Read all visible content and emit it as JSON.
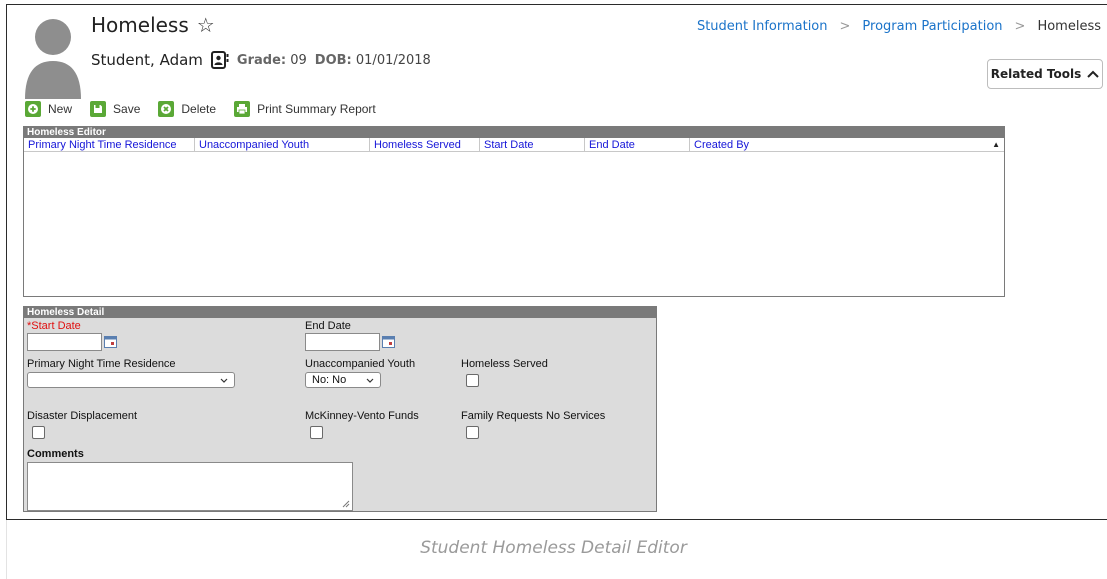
{
  "header": {
    "title": "Homeless",
    "student_name": "Student, Adam",
    "grade_label": "Grade:",
    "grade_value": "09",
    "dob_label": "DOB:",
    "dob_value": "01/01/2018"
  },
  "breadcrumb": {
    "items": [
      "Student Information",
      "Program Participation",
      "Homeless"
    ],
    "separator": ">"
  },
  "related_tools": {
    "label": "Related Tools"
  },
  "toolbar": {
    "new_label": "New",
    "save_label": "Save",
    "delete_label": "Delete",
    "print_label": "Print Summary Report"
  },
  "editor": {
    "title": "Homeless Editor",
    "columns": [
      "Primary Night Time Residence",
      "Unaccompanied Youth",
      "Homeless Served",
      "Start Date",
      "End Date",
      "Created By"
    ],
    "rows": []
  },
  "detail": {
    "title": "Homeless Detail",
    "start_date": {
      "label": "*Start Date",
      "value": ""
    },
    "end_date": {
      "label": "End Date",
      "value": ""
    },
    "primary_residence": {
      "label": "Primary Night Time Residence",
      "value": ""
    },
    "unaccompanied_youth": {
      "label": "Unaccompanied Youth",
      "value": "No: No"
    },
    "homeless_served": {
      "label": "Homeless Served",
      "checked": false
    },
    "disaster_displacement": {
      "label": "Disaster Displacement",
      "checked": false
    },
    "mckinney_vento": {
      "label": "McKinney-Vento Funds",
      "checked": false
    },
    "family_requests": {
      "label": "Family Requests No Services",
      "checked": false
    },
    "comments": {
      "label": "Comments",
      "value": ""
    }
  },
  "caption": "Student Homeless Detail Editor",
  "colors": {
    "accent_blue": "#1a73c9",
    "grid_header_text": "#1515d8",
    "panel_gray": "#7a7a7a",
    "detail_bg": "#dcdcdc",
    "button_green": "#5aa836",
    "required_red": "#e01010"
  }
}
